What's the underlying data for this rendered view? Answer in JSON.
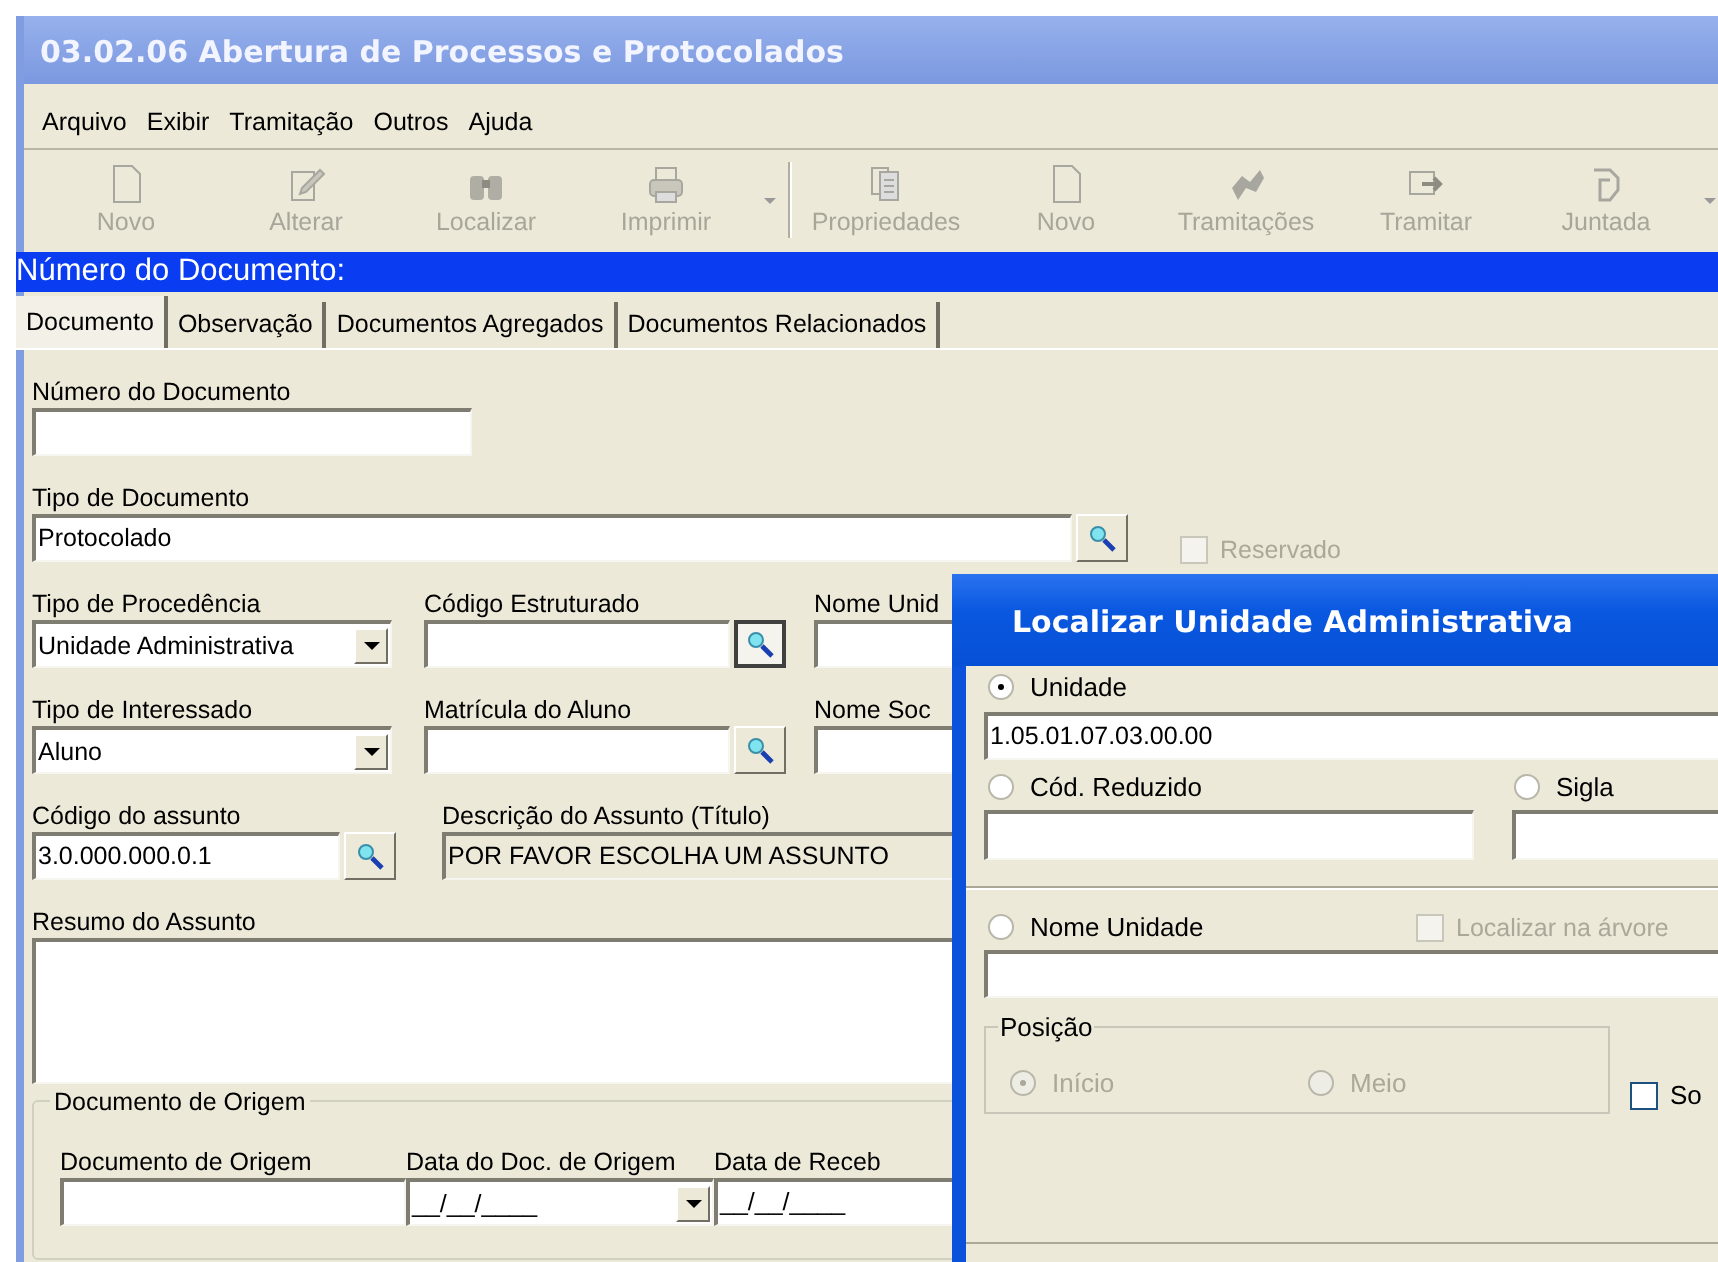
{
  "window": {
    "title": "03.02.06 Abertura de Processos e Protocolados"
  },
  "menu": [
    "Arquivo",
    "Exibir",
    "Tramitação",
    "Outros",
    "Ajuda"
  ],
  "toolbar": [
    {
      "kind": "new",
      "label": "Novo",
      "disabled": true
    },
    {
      "kind": "edit",
      "label": "Alterar",
      "disabled": true
    },
    {
      "kind": "find",
      "label": "Localizar",
      "disabled": true
    },
    {
      "kind": "print",
      "label": "Imprimir",
      "disabled": true
    },
    {
      "kind": "dropdown",
      "disabled": true
    },
    {
      "kind": "separator"
    },
    {
      "kind": "properties",
      "label": "Propriedades",
      "disabled": true
    },
    {
      "kind": "new",
      "label": "Novo",
      "disabled": true
    },
    {
      "kind": "transfers",
      "label": "Tramitações",
      "disabled": true
    },
    {
      "kind": "forward",
      "label": "Tramitar",
      "disabled": true
    },
    {
      "kind": "attach",
      "label": "Juntada",
      "disabled": true
    },
    {
      "kind": "dropdown",
      "disabled": true
    }
  ],
  "header_band": {
    "text": "Número do Documento:"
  },
  "tabs": [
    {
      "label": "Documento",
      "selected": true
    },
    {
      "label": "Observação",
      "selected": false
    },
    {
      "label": "Documentos Agregados",
      "selected": false
    },
    {
      "label": "Documentos Relacionados",
      "selected": false
    }
  ],
  "form": {
    "numero_documento": {
      "label": "Número do Documento"
    },
    "tipo_documento": {
      "label": "Tipo de Documento",
      "value": "Protocolado"
    },
    "reservado": {
      "label": "Reservado",
      "checked": false,
      "disabled": true
    },
    "tipo_procedencia": {
      "label": "Tipo de Procedência",
      "value": "Unidade Administrativa"
    },
    "codigo_estruturado": {
      "label": "Código Estruturado"
    },
    "nome_unidade": {
      "label": "Nome Unid"
    },
    "tipo_interessado": {
      "label": "Tipo de Interessado",
      "value": "Aluno"
    },
    "matricula_aluno": {
      "label": "Matrícula do Aluno"
    },
    "nome_social": {
      "label": "Nome Soc"
    },
    "codigo_assunto": {
      "label": "Código do assunto",
      "value": "3.0.000.000.0.1"
    },
    "descricao_assunto": {
      "label": "Descrição do Assunto (Título)",
      "value": "POR FAVOR ESCOLHA UM ASSUNTO"
    },
    "resumo_assunto": {
      "label": "Resumo do Assunto"
    },
    "documento_origem_group": {
      "title": "Documento de Origem",
      "documento_origem": {
        "label": "Documento de Origem"
      },
      "data_doc_origem": {
        "label": "Data do Doc. de Origem",
        "value": "__/__/____"
      },
      "data_recebimento": {
        "label": "Data de Receb",
        "value": "__/__/____"
      }
    }
  },
  "dialog": {
    "title": "Localizar Unidade Administrativa",
    "unidade": {
      "label": "Unidade",
      "selected": true,
      "value": "1.05.01.07.03.00.00"
    },
    "cod_reduzido": {
      "label": "Cód. Reduzido",
      "selected": false
    },
    "sigla": {
      "label": "Sigla",
      "selected": false
    },
    "nome_unidade": {
      "label": "Nome Unidade",
      "selected": false
    },
    "localizar_arvore": {
      "label": "Localizar na árvore",
      "checked": false,
      "disabled": true
    },
    "posicao": {
      "title": "Posição",
      "disabled": true,
      "options": [
        {
          "label": "Início",
          "selected": true
        },
        {
          "label": "Meio",
          "selected": false
        }
      ]
    },
    "so": {
      "label": "So",
      "checked": false
    }
  }
}
